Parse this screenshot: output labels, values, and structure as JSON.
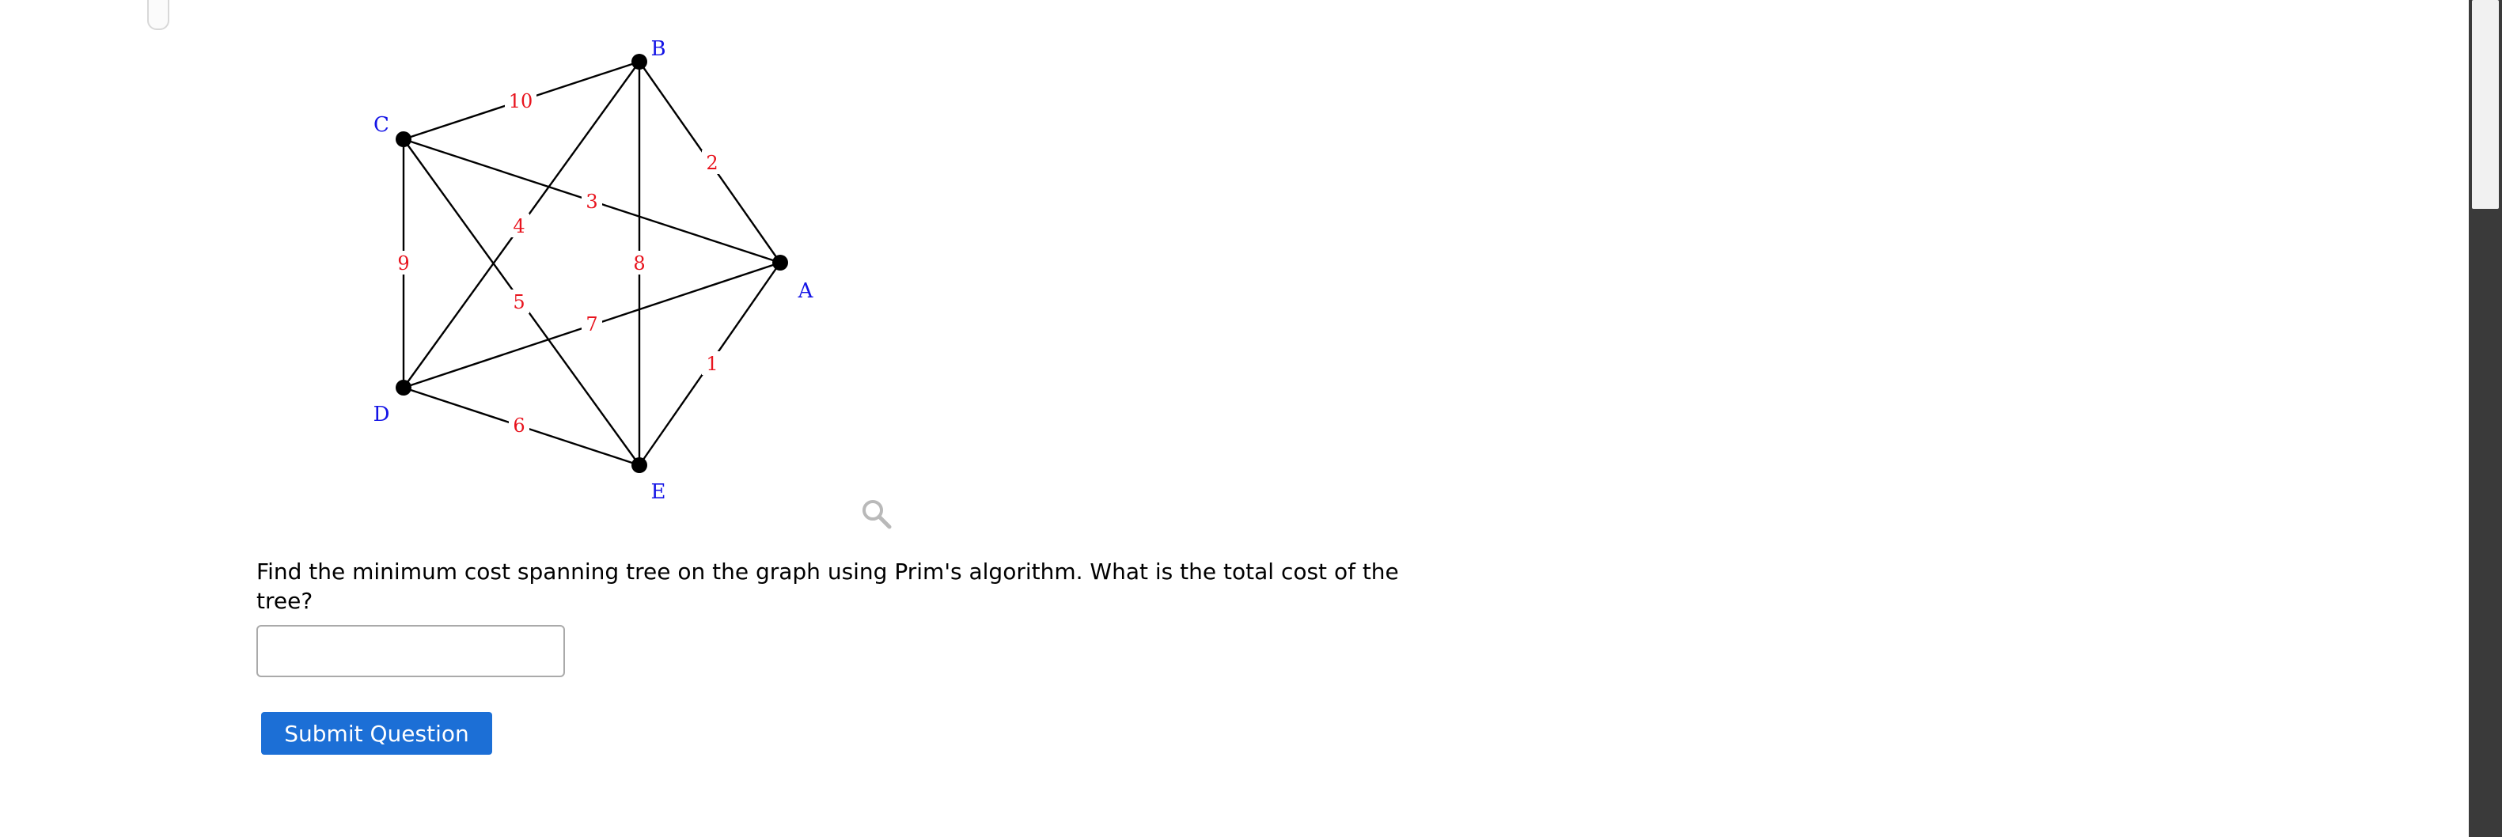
{
  "graph": {
    "nodes": [
      {
        "id": "A",
        "label": "A"
      },
      {
        "id": "B",
        "label": "B"
      },
      {
        "id": "C",
        "label": "C"
      },
      {
        "id": "D",
        "label": "D"
      },
      {
        "id": "E",
        "label": "E"
      }
    ],
    "edges": [
      {
        "from": "C",
        "to": "B",
        "weight": "10"
      },
      {
        "from": "B",
        "to": "A",
        "weight": "2"
      },
      {
        "from": "C",
        "to": "A",
        "weight": "3"
      },
      {
        "from": "D",
        "to": "B",
        "weight": "4"
      },
      {
        "from": "B",
        "to": "E",
        "weight": "8"
      },
      {
        "from": "C",
        "to": "D",
        "weight": "9"
      },
      {
        "from": "C",
        "to": "E",
        "weight": "5"
      },
      {
        "from": "D",
        "to": "A",
        "weight": "7"
      },
      {
        "from": "A",
        "to": "E",
        "weight": "1"
      },
      {
        "from": "D",
        "to": "E",
        "weight": "6"
      }
    ],
    "node_color": "#1414e6",
    "weight_color": "#e8141e"
  },
  "icons": {
    "zoom": "magnifier-icon"
  },
  "question": {
    "text": "Find the minimum cost spanning tree on the graph using Prim's algorithm. What is the total cost of the tree?"
  },
  "answer": {
    "value": "",
    "placeholder": ""
  },
  "submit": {
    "label": "Submit Question",
    "color": "#1c6fd6"
  }
}
